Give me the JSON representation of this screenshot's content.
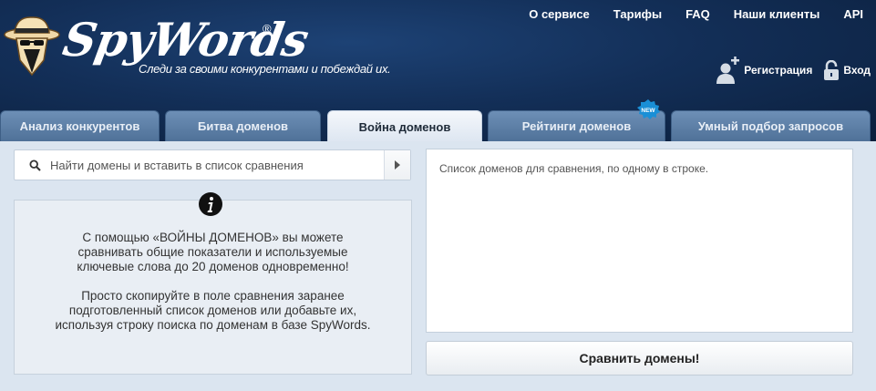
{
  "brand": {
    "name": "SpyWords",
    "reg": "®",
    "tagline": "Следи за своими конкурентами и побеждай их."
  },
  "topnav": [
    {
      "label": "О сервисе"
    },
    {
      "label": "Тарифы"
    },
    {
      "label": "FAQ"
    },
    {
      "label": "Наши клиенты"
    },
    {
      "label": "API"
    }
  ],
  "auth": {
    "register": "Регистрация",
    "login": "Вход"
  },
  "tabs": [
    {
      "label": "Анализ конкурентов",
      "active": false
    },
    {
      "label": "Битва доменов",
      "active": false
    },
    {
      "label": "Война доменов",
      "active": true
    },
    {
      "label": "Рейтинги доменов",
      "active": false
    },
    {
      "label": "Умный подбор запросов",
      "active": false
    }
  ],
  "badge_new": "NEW",
  "search": {
    "placeholder": "Найти домены и вставить в список сравнения"
  },
  "info": {
    "paragraph1": "С помощью «ВОЙНЫ ДОМЕНОВ» вы можете сравнивать общие показатели и используемые ключевые слова до 20 доменов одновременно!",
    "paragraph2": "Просто скопируйте в поле сравнения заранее подготовленный список доменов или добавьте их, используя строку поиска по доменам в базе SpyWords."
  },
  "domain_list": {
    "placeholder": "Список доменов для сравнения, по одному в строке."
  },
  "compare_button": "Сравнить домены!",
  "colors": {
    "header_bg": "#132f58",
    "tab_inactive": "#5a7ca3",
    "tab_active": "#eef3f8",
    "content_bg": "#dbe5f0",
    "badge": "#1a8fd6"
  }
}
